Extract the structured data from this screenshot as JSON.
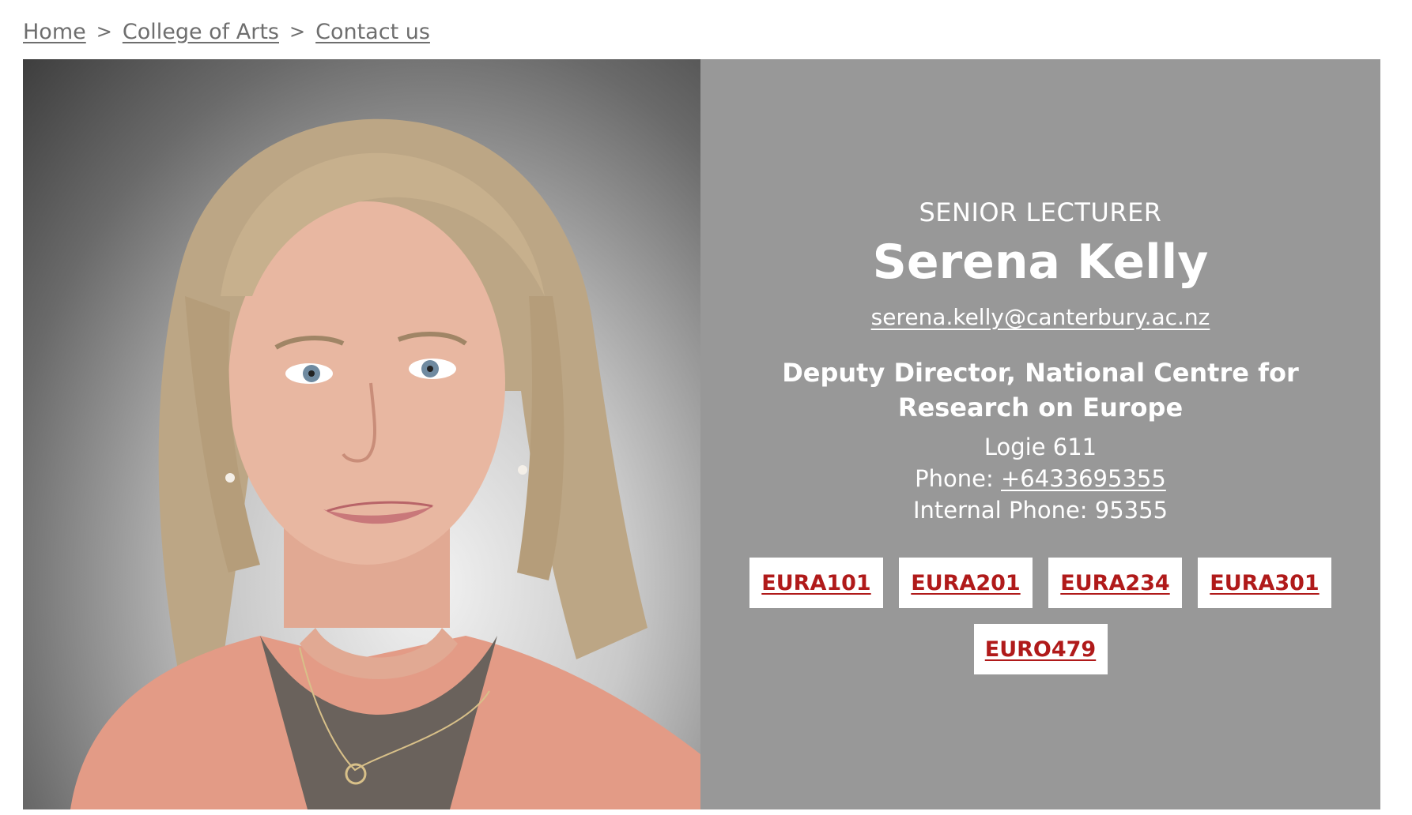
{
  "breadcrumb": {
    "items": [
      "Home",
      "College of Arts",
      "Contact us"
    ],
    "separator": ">"
  },
  "profile": {
    "photo_icon": "portrait-photo",
    "role": "SENIOR LECTURER",
    "name": "Serena Kelly",
    "email": "serena.kelly@canterbury.ac.nz",
    "position": "Deputy Director, National Centre for Research on Europe",
    "office": "Logie 611",
    "phone_label": "Phone:",
    "phone": "+6433695355",
    "internal_phone": "Internal Phone: 95355",
    "courses": [
      "EURA101",
      "EURA201",
      "EURA234",
      "EURA301",
      "EURO479"
    ]
  },
  "colors": {
    "panel_bg": "#989898",
    "course_text": "#b01a1a",
    "breadcrumb_text": "#6e6e6e"
  }
}
